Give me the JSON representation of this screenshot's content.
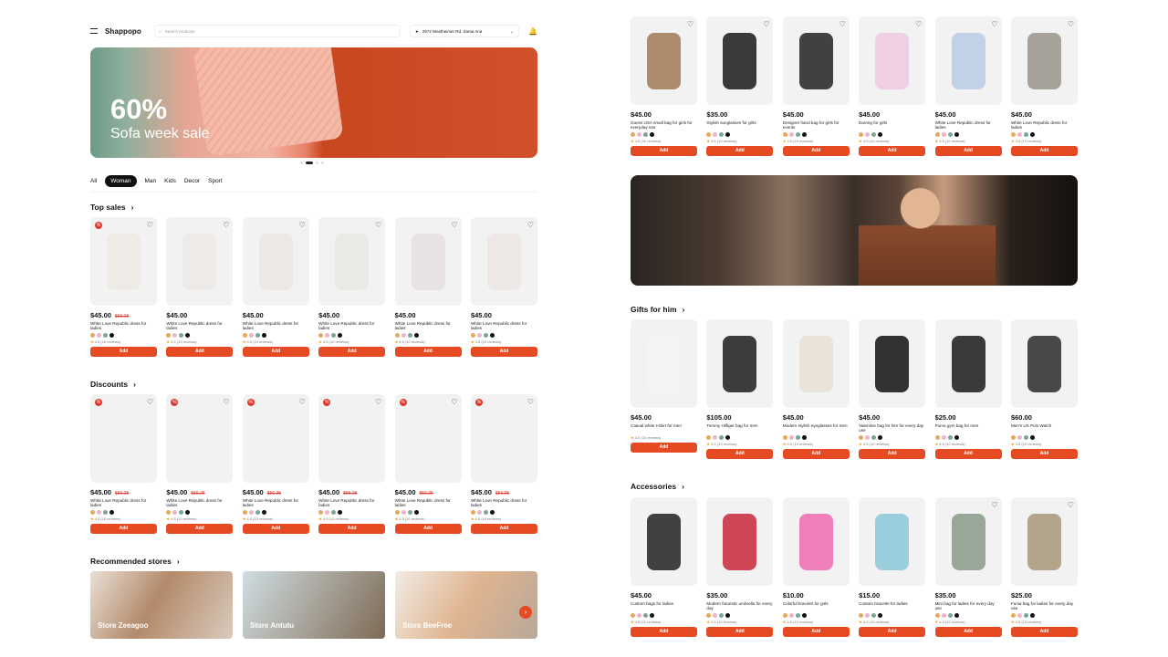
{
  "header": {
    "logo": "Shappopo",
    "search_placeholder": "Search products",
    "location": "2972 Westheimer Rd. Santa Ana"
  },
  "hero": {
    "percent": "60%",
    "text": "Sofa week sale"
  },
  "tabs": [
    "All",
    "Woman",
    "Man",
    "Kids",
    "Decor",
    "Sport"
  ],
  "sections": {
    "top_sales": "Top sales",
    "discounts": "Discounts",
    "recommended": "Recommended stores",
    "gifts": "Gifts for him",
    "accessories": "Accessories"
  },
  "add_label": "Add",
  "colors": {
    "accent": "#e54a22",
    "sale": "#e0382f"
  },
  "top_sales": [
    {
      "price": "$45.00",
      "old": "$56.25",
      "name": "White Love Republic dress for ladies",
      "reviews": "4.5 (10 reviews)"
    },
    {
      "price": "$45.00",
      "old": "",
      "name": "White Love Republic dress for ladies",
      "reviews": "4.5 (10 reviews)"
    },
    {
      "price": "$45.00",
      "old": "",
      "name": "White Love Republic dress for ladies",
      "reviews": "4.5 (10 reviews)"
    },
    {
      "price": "$45.00",
      "old": "",
      "name": "White Love Republic dress for ladies",
      "reviews": "4.5 (10 reviews)"
    },
    {
      "price": "$45.00",
      "old": "",
      "name": "White Love Republic dress for ladies",
      "reviews": "4.5 (10 reviews)"
    },
    {
      "price": "$45.00",
      "old": "",
      "name": "White Love Republic dress for ladies",
      "reviews": "4.5 (10 reviews)"
    }
  ],
  "discounts": [
    {
      "price": "$45.00",
      "old": "$56.25",
      "name": "White Love Republic dress for ladies",
      "reviews": "4.5 (10 reviews)"
    },
    {
      "price": "$45.00",
      "old": "$56.25",
      "name": "White Love Republic dress for ladies",
      "reviews": "4.5 (10 reviews)"
    },
    {
      "price": "$45.00",
      "old": "$56.25",
      "name": "White Love Republic dress for ladies",
      "reviews": "4.5 (10 reviews)"
    },
    {
      "price": "$45.00",
      "old": "$56.25",
      "name": "White Love Republic dress for ladies",
      "reviews": "4.5 (10 reviews)"
    },
    {
      "price": "$45.00",
      "old": "$56.25",
      "name": "White Love Republic dress for ladies",
      "reviews": "4.5 (10 reviews)"
    },
    {
      "price": "$45.00",
      "old": "$56.25",
      "name": "White Love Republic dress for ladies",
      "reviews": "4.5 (10 reviews)"
    }
  ],
  "stores": [
    "Store Zeeagoo",
    "Store Antutu",
    "Store BeeFree"
  ],
  "right_top": [
    {
      "price": "$45.00",
      "name": "Guess USA small bag for girls for everyday use",
      "reviews": "4.5 (10 reviews)"
    },
    {
      "price": "$35.00",
      "name": "Stylish sunglasses for girls",
      "reviews": "4.5 (10 reviews)"
    },
    {
      "price": "$45.00",
      "name": "Designer hand bag for girls for events",
      "reviews": "4.5 (10 reviews)"
    },
    {
      "price": "$45.00",
      "name": "Earring for girls",
      "reviews": "4.5 (10 reviews)"
    },
    {
      "price": "$45.00",
      "name": "White Love Republic dress for ladies",
      "reviews": "4.5 (10 reviews)"
    },
    {
      "price": "$45.00",
      "name": "White Love Republic dress for ladies",
      "reviews": "4.5 (10 reviews)"
    }
  ],
  "gifts": [
    {
      "price": "$45.00",
      "name": "Casual white t-shirt for men",
      "reviews": "4.5 (10 reviews)"
    },
    {
      "price": "$105.00",
      "name": "Tommy Hilfiger bag for men",
      "reviews": "4.5 (10 reviews)"
    },
    {
      "price": "$45.00",
      "name": "Modern stylish eyeglasses for men",
      "reviews": "4.5 (10 reviews)"
    },
    {
      "price": "$45.00",
      "name": "Valentine bag for him for every day use",
      "reviews": "4.5 (10 reviews)"
    },
    {
      "price": "$25.00",
      "name": "Puma gym bag for men",
      "reviews": "4.5 (10 reviews)"
    },
    {
      "price": "$60.00",
      "name": "Men's US Polo Watch",
      "reviews": "4.5 (10 reviews)"
    }
  ],
  "accessories": [
    {
      "price": "$45.00",
      "name": "Custom bags for ladies",
      "reviews": "4.5 (10 reviews)"
    },
    {
      "price": "$35.00",
      "name": "Modern futuristic umbrella for every day",
      "reviews": "4.5 (10 reviews)"
    },
    {
      "price": "$10.00",
      "name": "Colorful bracelet for girls",
      "reviews": "4.5 (10 reviews)"
    },
    {
      "price": "$15.00",
      "name": "Custom bracelet for ladies",
      "reviews": "4.5 (10 reviews)"
    },
    {
      "price": "$35.00",
      "name": "Mini bag for ladies for every day use",
      "reviews": "4.5 (10 reviews)"
    },
    {
      "price": "$25.00",
      "name": "Funia bag for ladies for every day use",
      "reviews": "4.5 (10 reviews)"
    }
  ]
}
